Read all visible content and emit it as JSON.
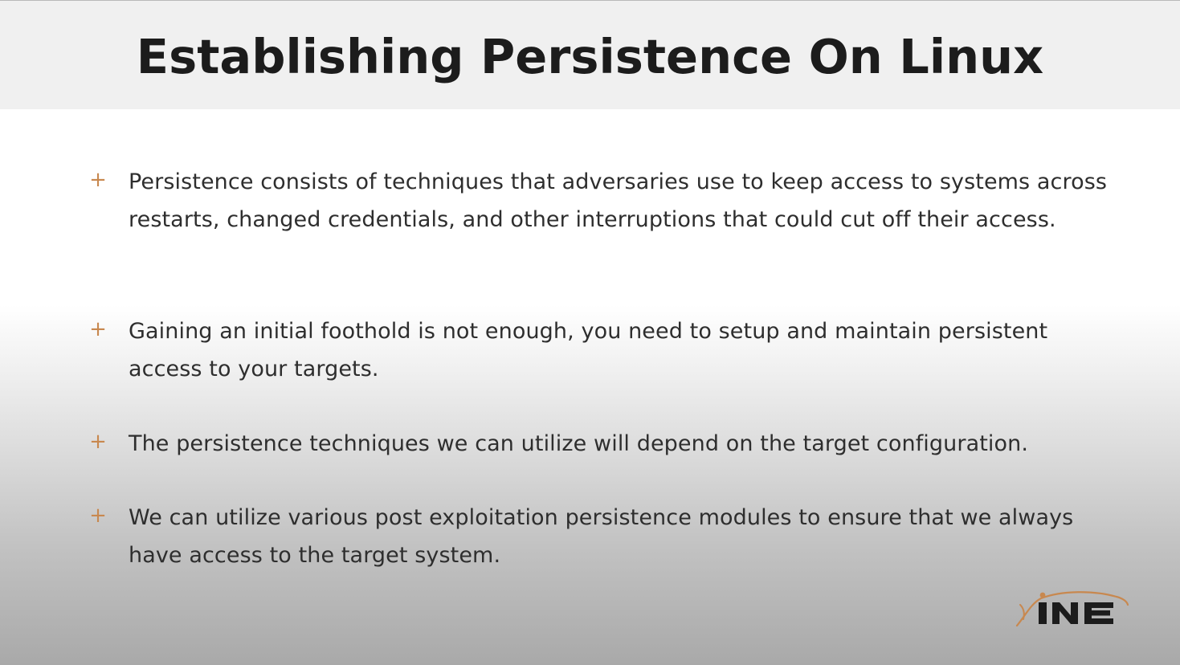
{
  "slide": {
    "title": "Establishing Persistence On Linux",
    "bullet_marker": "+",
    "bullets": [
      {
        "text": "Persistence consists of techniques that adversaries use to keep access to systems across restarts, changed credentials, and other interruptions that could cut off their access."
      },
      {
        "text": "Gaining an initial foothold is not enough, you need to setup and maintain persistent access to your targets."
      },
      {
        "text": "The persistence techniques we can utilize will depend on the target configuration."
      },
      {
        "text": "We can utilize various post exploitation persistence modules to ensure that we always have access to the target system."
      }
    ]
  },
  "logo": {
    "text": "INE",
    "icon": "ine-logo",
    "accent_color": "#c8884f",
    "text_color": "#1c1c1c"
  },
  "colors": {
    "title_bar": "#f0f0f0",
    "title_text": "#1c1c1c",
    "body_text": "#2e2e2e",
    "bullet_marker": "#c8884f"
  }
}
